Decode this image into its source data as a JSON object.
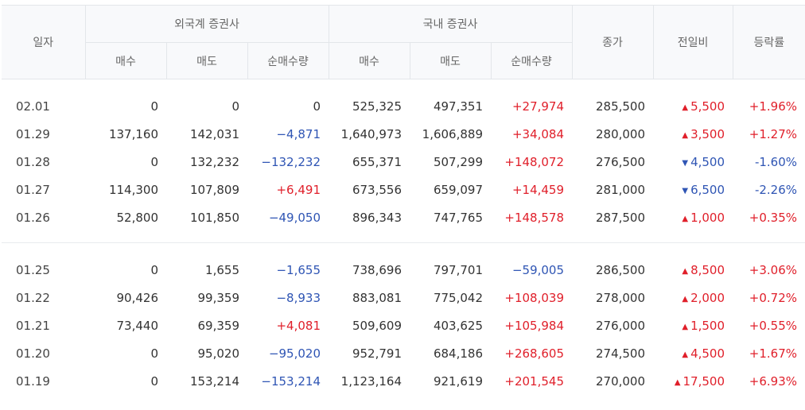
{
  "headers": {
    "date": "일자",
    "foreign": "외국계 증권사",
    "domestic": "국내 증권사",
    "close": "종가",
    "change": "전일비",
    "rate": "등락률",
    "buy": "매수",
    "sell": "매도",
    "net": "순매수량"
  },
  "groups": [
    [
      {
        "date": "02.01",
        "f_buy": "0",
        "f_sell": "0",
        "f_net": "0",
        "f_net_dir": "none",
        "d_buy": "525,325",
        "d_sell": "497,351",
        "d_net": "+27,974",
        "d_net_dir": "up",
        "close": "285,500",
        "change": "5,500",
        "change_dir": "up",
        "rate": "+1.96%"
      },
      {
        "date": "01.29",
        "f_buy": "137,160",
        "f_sell": "142,031",
        "f_net": "−4,871",
        "f_net_dir": "down",
        "d_buy": "1,640,973",
        "d_sell": "1,606,889",
        "d_net": "+34,084",
        "d_net_dir": "up",
        "close": "280,000",
        "change": "3,500",
        "change_dir": "up",
        "rate": "+1.27%"
      },
      {
        "date": "01.28",
        "f_buy": "0",
        "f_sell": "132,232",
        "f_net": "−132,232",
        "f_net_dir": "down",
        "d_buy": "655,371",
        "d_sell": "507,299",
        "d_net": "+148,072",
        "d_net_dir": "up",
        "close": "276,500",
        "change": "4,500",
        "change_dir": "down",
        "rate": "-1.60%"
      },
      {
        "date": "01.27",
        "f_buy": "114,300",
        "f_sell": "107,809",
        "f_net": "+6,491",
        "f_net_dir": "up",
        "d_buy": "673,556",
        "d_sell": "659,097",
        "d_net": "+14,459",
        "d_net_dir": "up",
        "close": "281,000",
        "change": "6,500",
        "change_dir": "down",
        "rate": "-2.26%"
      },
      {
        "date": "01.26",
        "f_buy": "52,800",
        "f_sell": "101,850",
        "f_net": "−49,050",
        "f_net_dir": "down",
        "d_buy": "896,343",
        "d_sell": "747,765",
        "d_net": "+148,578",
        "d_net_dir": "up",
        "close": "287,500",
        "change": "1,000",
        "change_dir": "up",
        "rate": "+0.35%"
      }
    ],
    [
      {
        "date": "01.25",
        "f_buy": "0",
        "f_sell": "1,655",
        "f_net": "−1,655",
        "f_net_dir": "down",
        "d_buy": "738,696",
        "d_sell": "797,701",
        "d_net": "−59,005",
        "d_net_dir": "down",
        "close": "286,500",
        "change": "8,500",
        "change_dir": "up",
        "rate": "+3.06%"
      },
      {
        "date": "01.22",
        "f_buy": "90,426",
        "f_sell": "99,359",
        "f_net": "−8,933",
        "f_net_dir": "down",
        "d_buy": "883,081",
        "d_sell": "775,042",
        "d_net": "+108,039",
        "d_net_dir": "up",
        "close": "278,000",
        "change": "2,000",
        "change_dir": "up",
        "rate": "+0.72%"
      },
      {
        "date": "01.21",
        "f_buy": "73,440",
        "f_sell": "69,359",
        "f_net": "+4,081",
        "f_net_dir": "up",
        "d_buy": "509,609",
        "d_sell": "403,625",
        "d_net": "+105,984",
        "d_net_dir": "up",
        "close": "276,000",
        "change": "1,500",
        "change_dir": "up",
        "rate": "+0.55%"
      },
      {
        "date": "01.20",
        "f_buy": "0",
        "f_sell": "95,020",
        "f_net": "−95,020",
        "f_net_dir": "down",
        "d_buy": "952,791",
        "d_sell": "684,186",
        "d_net": "+268,605",
        "d_net_dir": "up",
        "close": "274,500",
        "change": "4,500",
        "change_dir": "up",
        "rate": "+1.67%"
      },
      {
        "date": "01.19",
        "f_buy": "0",
        "f_sell": "153,214",
        "f_net": "−153,214",
        "f_net_dir": "down",
        "d_buy": "1,123,164",
        "d_sell": "921,619",
        "d_net": "+201,545",
        "d_net_dir": "up",
        "close": "270,000",
        "change": "17,500",
        "change_dir": "up",
        "rate": "+6.93%"
      }
    ]
  ],
  "colors": {
    "up": "#e01f2a",
    "down": "#2f55b4",
    "header_bg": "#f8f9fb",
    "border": "#e3e6ea"
  },
  "icons": {
    "up": "triangle-up-icon",
    "down": "triangle-down-icon"
  }
}
